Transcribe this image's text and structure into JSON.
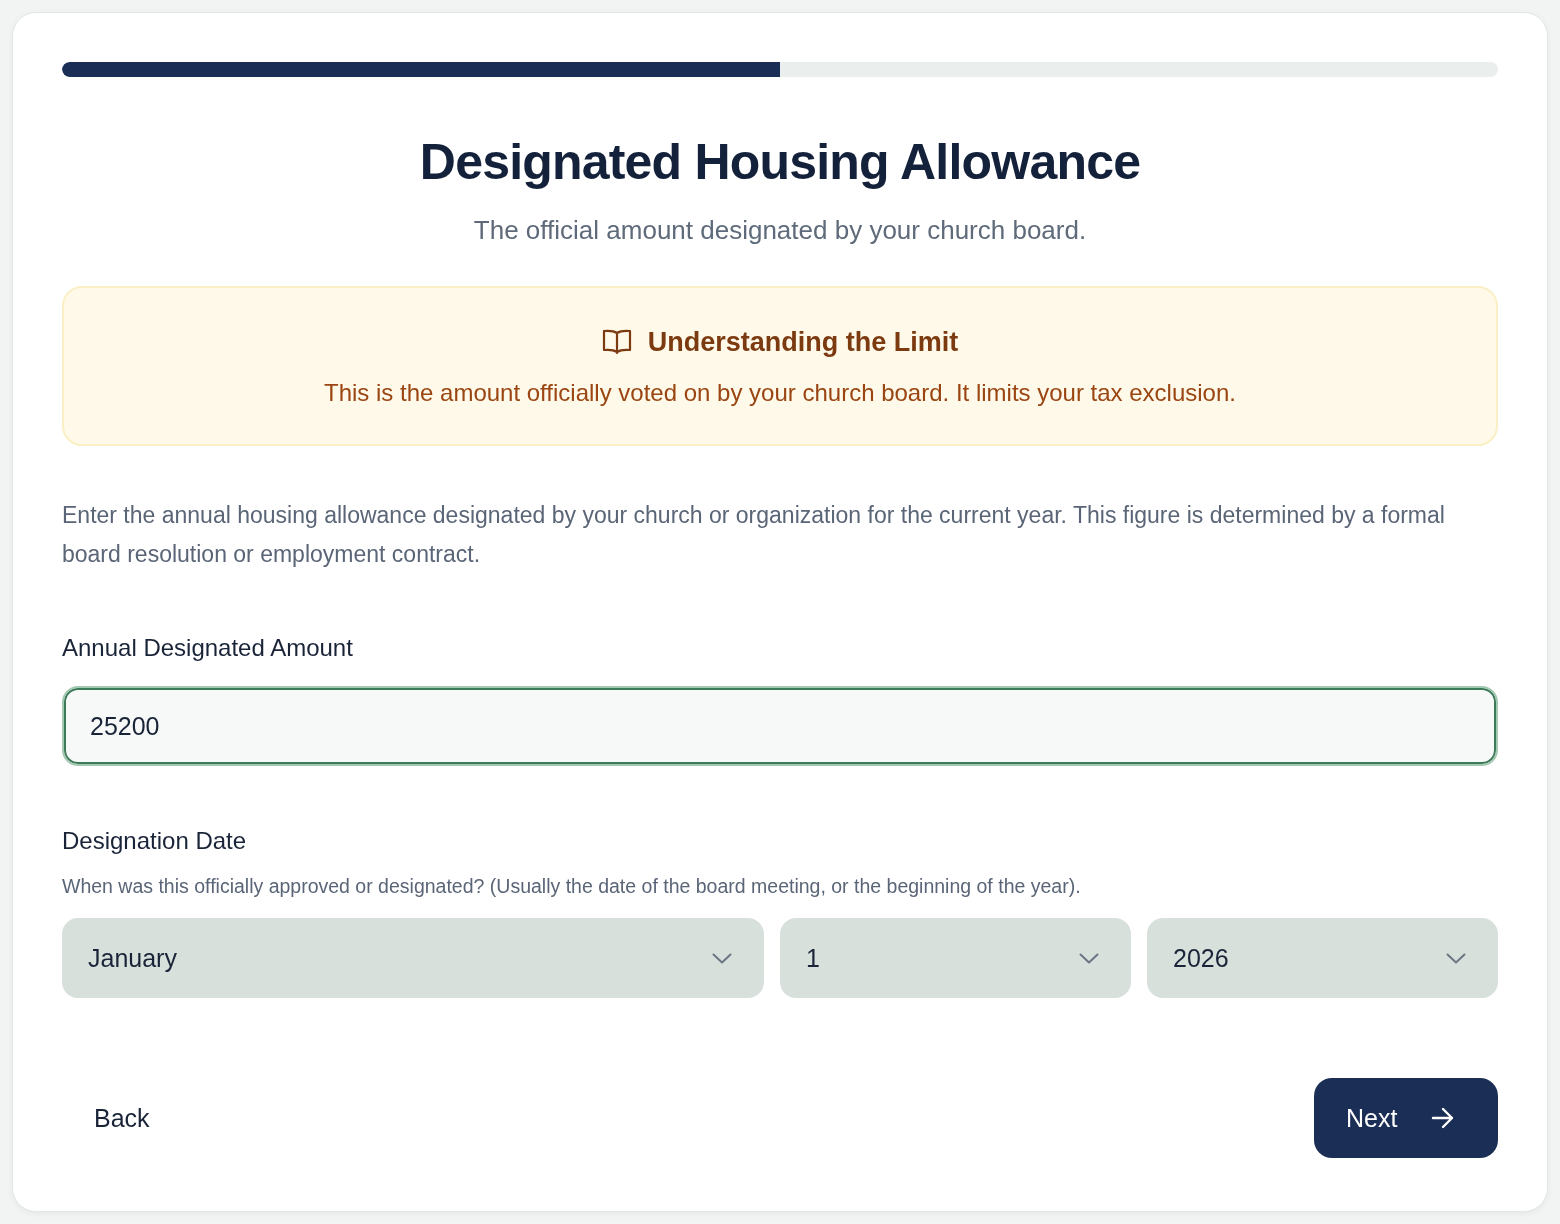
{
  "progress": {
    "level": 0.5
  },
  "header": {
    "title": "Designated Housing Allowance",
    "subtitle": "The official amount designated by your church board."
  },
  "info_box": {
    "title": "Understanding the Limit",
    "text": "This is the amount officially voted on by your church board. It limits your tax exclusion."
  },
  "description": "Enter the annual housing allowance designated by your church or organization for the current year. This figure is determined by a formal board resolution or employment contract.",
  "fields": [
    {
      "kind": "text",
      "label": "Annual Designated Amount",
      "value": "25200",
      "focused": true
    },
    {
      "kind": "date",
      "label": "Designation Date",
      "hint": "When was this officially approved or designated? (Usually the date of the board meeting, or the beginning of the year).",
      "selects": [
        {
          "value": "January"
        },
        {
          "value": "1"
        },
        {
          "value": "2026"
        }
      ]
    }
  ],
  "buttons": [
    {
      "kind": "back",
      "label": "Back"
    },
    {
      "kind": "next",
      "label": "Next"
    }
  ]
}
